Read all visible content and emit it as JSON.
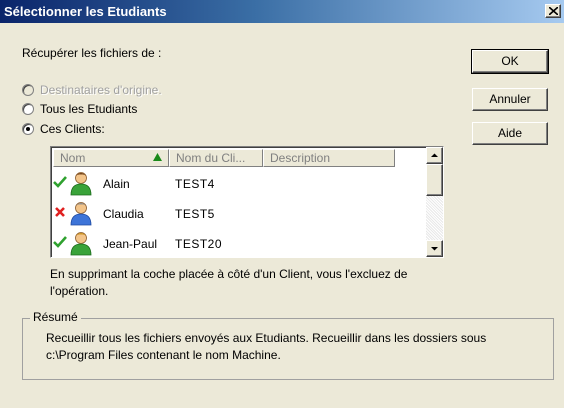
{
  "window": {
    "title": "Sélectionner les Etudiants"
  },
  "retrieve_label": "Récupérer les fichiers de :",
  "radios": [
    {
      "label": "Destinataires d'origine.",
      "selected": false,
      "disabled": true
    },
    {
      "label": "Tous les Etudiants",
      "selected": false,
      "disabled": false
    },
    {
      "label": "Ces Clients:",
      "selected": true,
      "disabled": false
    }
  ],
  "buttons": {
    "ok": "OK",
    "cancel": "Annuler",
    "help": "Aide"
  },
  "table": {
    "columns": [
      "Nom",
      "Nom du Cli...",
      "Description"
    ],
    "sort_indicator": "ascending",
    "rows": [
      {
        "name": "Alain",
        "client": "TEST4",
        "description": "",
        "checked": true
      },
      {
        "name": "Claudia",
        "client": "TEST5",
        "description": "",
        "checked": false
      },
      {
        "name": "Jean-Paul",
        "client": "TEST20",
        "description": "",
        "checked": true
      }
    ]
  },
  "note": "En supprimant la coche placée à côté d'un Client, vous l'excluez de l'opération.",
  "summary": {
    "legend": "Résumé",
    "text": "Recueillir tous les fichiers envoyés aux Etudiants. Recueillir dans les dossiers sous c:\\Program Files contenant le nom Machine."
  },
  "colors": {
    "check": "#2fa12f",
    "cross": "#e02020",
    "sort_arrow": "#1a8a1a"
  }
}
